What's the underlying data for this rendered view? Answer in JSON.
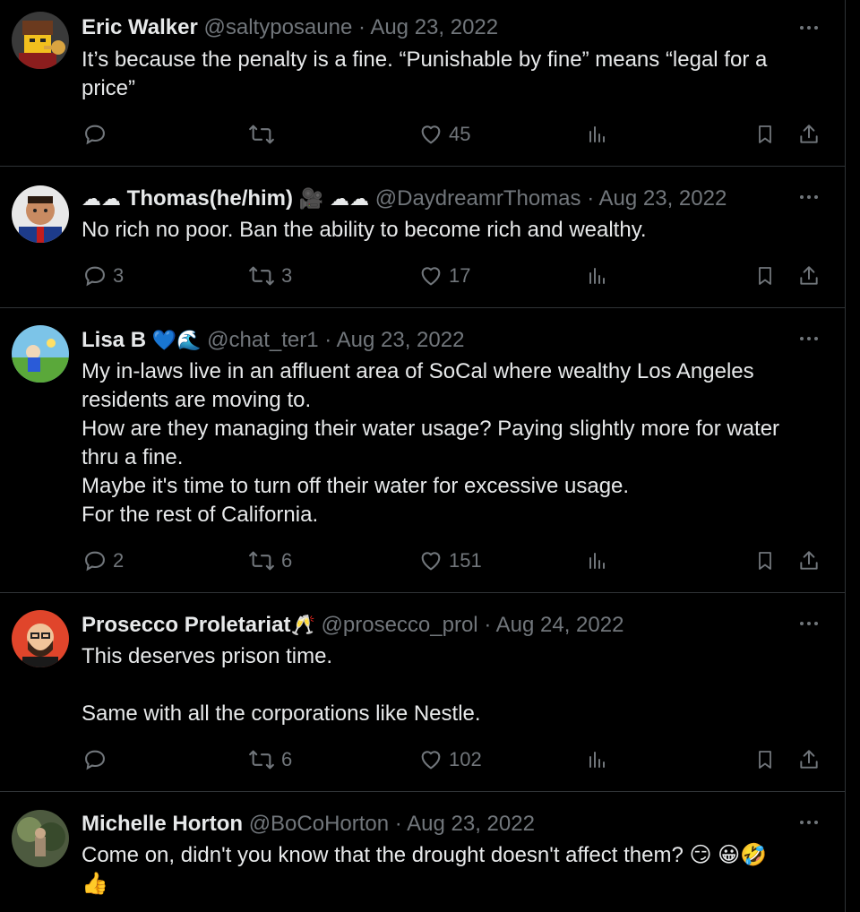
{
  "colors": {
    "background": "#000000",
    "text": "#e7e9ea",
    "muted": "#71767b",
    "divider": "#2f3336"
  },
  "tweets": [
    {
      "name": "Eric Walker",
      "handle": "@saltyposaune",
      "date": "Aug 23, 2022",
      "text": "It’s because the penalty is a fine.  “Punishable by fine” means “legal for a price”",
      "replies": "",
      "retweets": "",
      "likes": "45"
    },
    {
      "name_prefix": "☁☁",
      "name": "Thomas(he/him)",
      "name_suffix": "🎥 ☁☁",
      "handle": "@DaydreamrThomas",
      "date": "Aug 23, 2022",
      "text": "No rich no poor. Ban the ability to become rich and wealthy.",
      "replies": "3",
      "retweets": "3",
      "likes": "17"
    },
    {
      "name": "Lisa B",
      "name_suffix": "💙🌊",
      "handle": "@chat_ter1",
      "date": "Aug 23, 2022",
      "text": "My in-laws live in an affluent area of SoCal where wealthy Los Angeles residents are moving to.\nHow are they managing their water usage? Paying slightly more for water thru a fine.\nMaybe it's time to turn off their water for excessive usage.\nFor the rest of California.",
      "replies": "2",
      "retweets": "6",
      "likes": "151"
    },
    {
      "name": "Prosecco Proletariat",
      "name_suffix": "🥂",
      "handle": "@prosecco_prol",
      "date": "Aug 24, 2022",
      "text": "This deserves prison time.\n\nSame with all the corporations like Nestle.",
      "replies": "",
      "retweets": "6",
      "likes": "102"
    },
    {
      "name": "Michelle Horton",
      "handle": "@BoCoHorton",
      "date": "Aug 23, 2022",
      "text": "Come on, didn't you know that the drought doesn't affect them? 😏 😀🤣\n👍"
    }
  ],
  "icons": [
    "avatar",
    "more-icon",
    "reply-icon",
    "retweet-icon",
    "like-icon",
    "views-icon",
    "bookmark-icon",
    "share-icon"
  ]
}
